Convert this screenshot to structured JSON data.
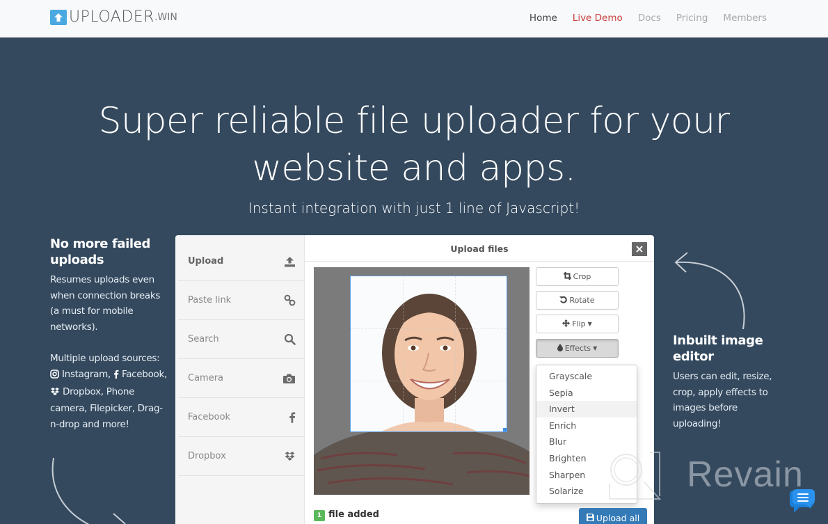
{
  "brand": {
    "logo_main": "UPLOADER",
    "logo_suffix": ".WIN",
    "accent": "#4aa9e0"
  },
  "nav": {
    "items": [
      {
        "label": "Home",
        "state": "current"
      },
      {
        "label": "Live Demo",
        "state": "highlight"
      },
      {
        "label": "Docs",
        "state": "normal"
      },
      {
        "label": "Pricing",
        "state": "normal"
      },
      {
        "label": "Members",
        "state": "normal"
      }
    ]
  },
  "hero": {
    "title_line1": "Super reliable file uploader for your",
    "title_line2": "website and apps.",
    "subtitle": "Instant integration with just 1 line of Javascript!"
  },
  "features": {
    "left": {
      "heading": "No more failed uploads",
      "para1": "Resumes uploads even when connection breaks (a must for mobile networks).",
      "para2_prefix": "Multiple upload sources:",
      "instagram": "Instagram,",
      "facebook": "Facebook,",
      "para2_suffix": "Dropbox, Phone camera, Filepicker, Drag-n-drop and more!"
    },
    "right": {
      "heading": "Inbuilt image editor",
      "para": "Users can edit, resize, crop, apply effects to images before uploading!"
    }
  },
  "widget": {
    "title": "Upload files",
    "close_label": "×",
    "sources": [
      {
        "label": "Upload",
        "icon": "upload-icon",
        "active": true
      },
      {
        "label": "Paste link",
        "icon": "link-icon",
        "active": false
      },
      {
        "label": "Search",
        "icon": "search-icon",
        "active": false
      },
      {
        "label": "Camera",
        "icon": "camera-icon",
        "active": false
      },
      {
        "label": "Facebook",
        "icon": "facebook-icon",
        "active": false
      },
      {
        "label": "Dropbox",
        "icon": "dropbox-icon",
        "active": false
      }
    ],
    "tools": {
      "crop": "Crop",
      "rotate": "Rotate",
      "flip": "Flip",
      "effects": "Effects"
    },
    "effects_menu": [
      "Grayscale",
      "Sepia",
      "Invert",
      "Enrich",
      "Blur",
      "Brighten",
      "Sharpen",
      "Solarize"
    ],
    "hovered_effect": "Invert",
    "file_count": "1",
    "file_count_label": "file added",
    "upload_all": "Upload all"
  },
  "watermark": {
    "text": "Revain"
  }
}
